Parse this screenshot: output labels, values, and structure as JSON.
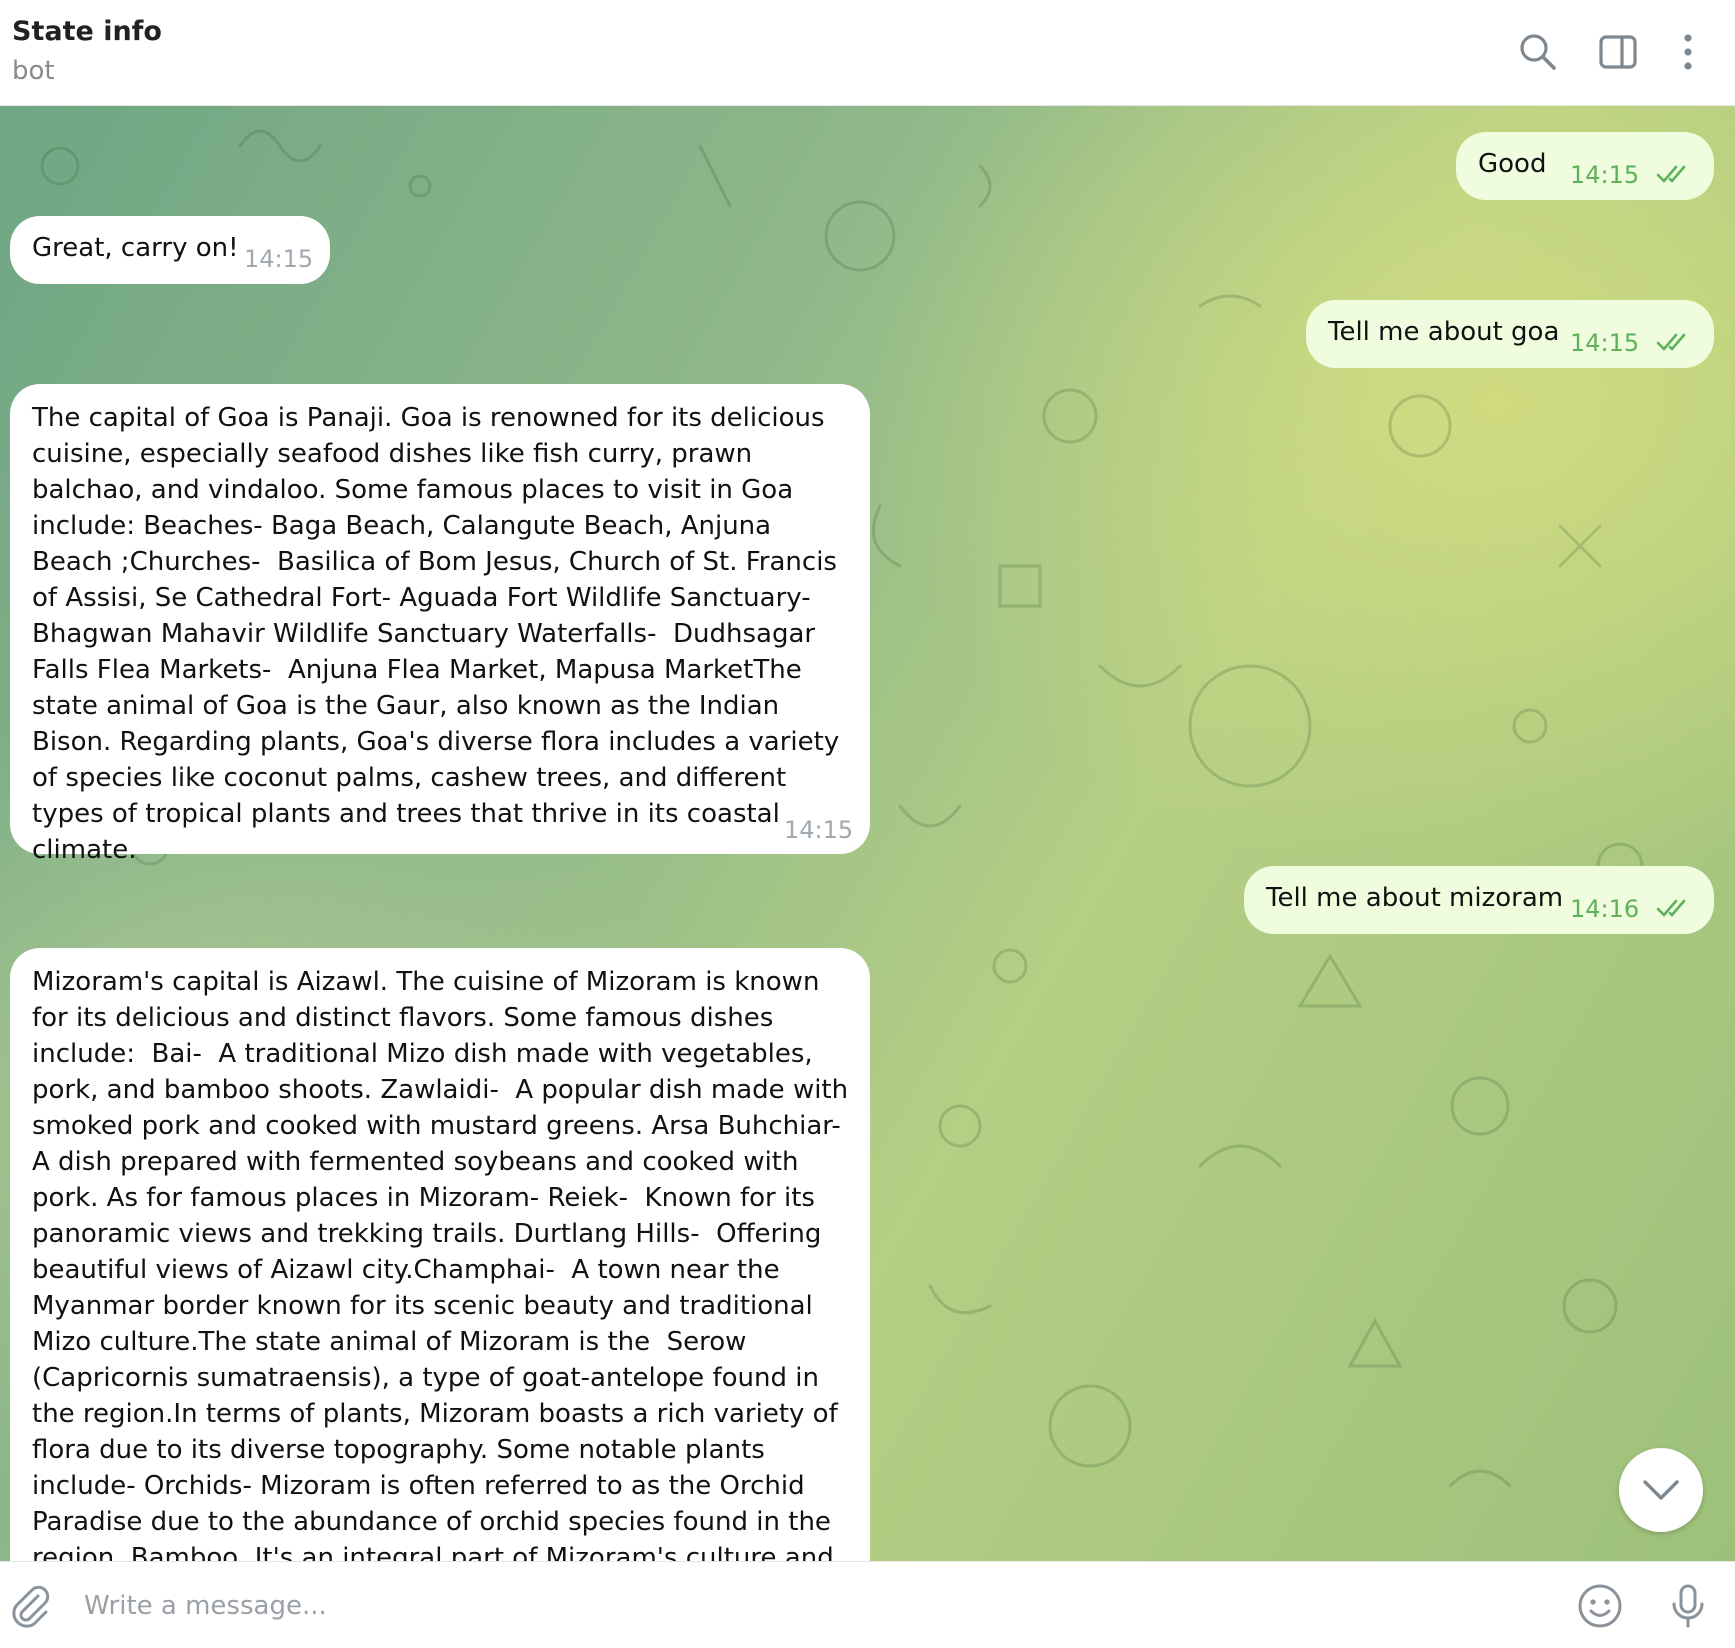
{
  "header": {
    "title": "State info",
    "status": "bot",
    "icons": [
      "search-icon",
      "sidebar-toggle-icon",
      "more-vertical-icon"
    ]
  },
  "messages": [
    {
      "direction": "out",
      "text": "Good",
      "time": "14:15",
      "status": "read"
    },
    {
      "direction": "in",
      "text": "Great, carry on!",
      "time": "14:15"
    },
    {
      "direction": "out",
      "text": "Tell me about goa",
      "time": "14:15",
      "status": "read"
    },
    {
      "direction": "in",
      "text": "The capital of Goa is Panaji. Goa is renowned for its delicious cuisine, especially seafood dishes like fish curry, prawn balchao, and vindaloo. Some famous places to visit in Goa include: Beaches- Baga Beach, Calangute Beach, Anjuna Beach ;Churches-  Basilica of Bom Jesus, Church of St. Francis of Assisi, Se Cathedral Fort- Aguada Fort Wildlife Sanctuary-  Bhagwan Mahavir Wildlife Sanctuary Waterfalls-  Dudhsagar Falls Flea Markets-  Anjuna Flea Market, Mapusa MarketThe state animal of Goa is the Gaur, also known as the Indian Bison. Regarding plants, Goa's diverse flora includes a variety of species like coconut palms, cashew trees, and different types of tropical plants and trees that thrive in its coastal climate.",
      "time": "14:15"
    },
    {
      "direction": "out",
      "text": "Tell me about mizoram",
      "time": "14:16",
      "status": "read"
    },
    {
      "direction": "in",
      "text": "Mizoram's capital is Aizawl. The cuisine of Mizoram is known for its delicious and distinct flavors. Some famous dishes include:  Bai-  A traditional Mizo dish made with vegetables, pork, and bamboo shoots. Zawlaidi-  A popular dish made with smoked pork and cooked with mustard greens. Arsa Buhchiar-  A dish prepared with fermented soybeans and cooked with pork. As for famous places in Mizoram- Reiek-  Known for its panoramic views and trekking trails. Durtlang Hills-  Offering beautiful views of Aizawl city.Champhai-  A town near the Myanmar border known for its scenic beauty and traditional Mizo culture.The state animal of Mizoram is the  Serow (Capricornis sumatraensis), a type of goat-antelope found in the region.In terms of plants, Mizoram boasts a rich variety of flora due to its diverse topography. Some notable plants include- Orchids- Mizoram is often referred to as the Orchid Paradise due to the abundance of orchid species found in the region. Bamboo  It's an integral part of Mizoram's culture and economy, used in various aspects of daily life.Rhododendrons These colorful flowering plants"
    }
  ],
  "composer": {
    "placeholder": "Write a message..."
  },
  "colors": {
    "incoming_bubble": "#ffffff",
    "outgoing_bubble": "#effdde",
    "read_ticks": "#5fb05a",
    "time_incoming": "#a0a8b0"
  }
}
